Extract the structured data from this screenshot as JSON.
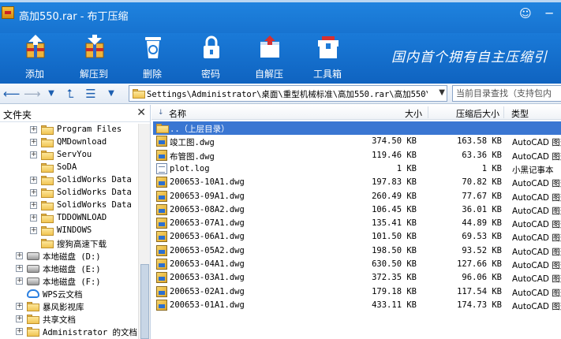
{
  "window": {
    "title": "高加550.rar - 布丁压缩",
    "buttons": [
      "☺",
      "─"
    ]
  },
  "toolbar": {
    "items": [
      {
        "label": "添加",
        "icon": "add-archive-icon"
      },
      {
        "label": "解压到",
        "icon": "extract-archive-icon"
      },
      {
        "label": "删除",
        "icon": "recycle-bin-icon"
      },
      {
        "label": "密码",
        "icon": "lock-icon"
      },
      {
        "label": "自解压",
        "icon": "self-extract-icon"
      },
      {
        "label": "工具箱",
        "icon": "toolbox-icon"
      }
    ],
    "slogan": "国内首个拥有自主压缩引"
  },
  "addressbar": {
    "path": "Settings\\Administrator\\桌面\\重型机械标准\\高加550.rar\\高加550\\",
    "search_placeholder": "当前目录查找（支持包内"
  },
  "leftpane": {
    "title": "文件夹",
    "tree": [
      {
        "label": "Program Files",
        "indent": 2,
        "icon": "folder",
        "expandable": true
      },
      {
        "label": "QMDownload",
        "indent": 2,
        "icon": "folder",
        "expandable": true
      },
      {
        "label": "ServYou",
        "indent": 2,
        "icon": "folder",
        "expandable": true
      },
      {
        "label": "SoDA",
        "indent": 2,
        "icon": "folder",
        "expandable": false
      },
      {
        "label": "SolidWorks Data",
        "indent": 2,
        "icon": "folder",
        "expandable": true
      },
      {
        "label": "SolidWorks Data",
        "indent": 2,
        "icon": "folder",
        "expandable": true
      },
      {
        "label": "SolidWorks Data",
        "indent": 2,
        "icon": "folder",
        "expandable": true
      },
      {
        "label": "TDDOWNLOAD",
        "indent": 2,
        "icon": "folder",
        "expandable": true
      },
      {
        "label": "WINDOWS",
        "indent": 2,
        "icon": "folder",
        "expandable": true
      },
      {
        "label": "搜狗高速下载",
        "indent": 2,
        "icon": "folder",
        "expandable": false
      },
      {
        "label": "本地磁盘 (D:)",
        "indent": 1,
        "icon": "disk",
        "expandable": true
      },
      {
        "label": "本地磁盘 (E:)",
        "indent": 1,
        "icon": "disk",
        "expandable": true
      },
      {
        "label": "本地磁盘 (F:)",
        "indent": 1,
        "icon": "disk",
        "expandable": true
      },
      {
        "label": "WPS云文档",
        "indent": 1,
        "icon": "cloud",
        "expandable": false
      },
      {
        "label": "暴风影视库",
        "indent": 1,
        "icon": "folder",
        "expandable": true
      },
      {
        "label": "共享文档",
        "indent": 1,
        "icon": "folder",
        "expandable": true
      },
      {
        "label": "Administrator 的文档",
        "indent": 1,
        "icon": "folder",
        "expandable": true
      }
    ]
  },
  "filelist": {
    "columns": {
      "name": "名称",
      "size": "大小",
      "packed": "压缩后大小",
      "type": "类型"
    },
    "rows": [
      {
        "name": "..（上层目录）",
        "size": "",
        "packed": "",
        "type": "",
        "icon": "folder",
        "selected": true
      },
      {
        "name": "竣工图.dwg",
        "size": "374.50 KB",
        "packed": "163.58 KB",
        "type": "AutoCAD 图形",
        "icon": "dwg"
      },
      {
        "name": "布管图.dwg",
        "size": "119.46 KB",
        "packed": "63.36 KB",
        "type": "AutoCAD 图形",
        "icon": "dwg"
      },
      {
        "name": "plot.log",
        "size": "1 KB",
        "packed": "1 KB",
        "type": "小黑记事本",
        "icon": "txt"
      },
      {
        "name": "200653-10A1.dwg",
        "size": "197.83 KB",
        "packed": "70.82 KB",
        "type": "AutoCAD 图形",
        "icon": "dwg"
      },
      {
        "name": "200653-09A1.dwg",
        "size": "260.49 KB",
        "packed": "77.67 KB",
        "type": "AutoCAD 图形",
        "icon": "dwg"
      },
      {
        "name": "200653-08A2.dwg",
        "size": "106.45 KB",
        "packed": "36.01 KB",
        "type": "AutoCAD 图形",
        "icon": "dwg"
      },
      {
        "name": "200653-07A1.dwg",
        "size": "135.41 KB",
        "packed": "44.89 KB",
        "type": "AutoCAD 图形",
        "icon": "dwg"
      },
      {
        "name": "200653-06A1.dwg",
        "size": "101.50 KB",
        "packed": "69.53 KB",
        "type": "AutoCAD 图形",
        "icon": "dwg"
      },
      {
        "name": "200653-05A2.dwg",
        "size": "198.50 KB",
        "packed": "93.52 KB",
        "type": "AutoCAD 图形",
        "icon": "dwg"
      },
      {
        "name": "200653-04A1.dwg",
        "size": "630.50 KB",
        "packed": "127.66 KB",
        "type": "AutoCAD 图形",
        "icon": "dwg"
      },
      {
        "name": "200653-03A1.dwg",
        "size": "372.35 KB",
        "packed": "96.06 KB",
        "type": "AutoCAD 图形",
        "icon": "dwg"
      },
      {
        "name": "200653-02A1.dwg",
        "size": "179.18 KB",
        "packed": "117.54 KB",
        "type": "AutoCAD 图形",
        "icon": "dwg"
      },
      {
        "name": "200653-01A1.dwg",
        "size": "433.11 KB",
        "packed": "174.73 KB",
        "type": "AutoCAD 图形",
        "icon": "dwg"
      }
    ]
  }
}
